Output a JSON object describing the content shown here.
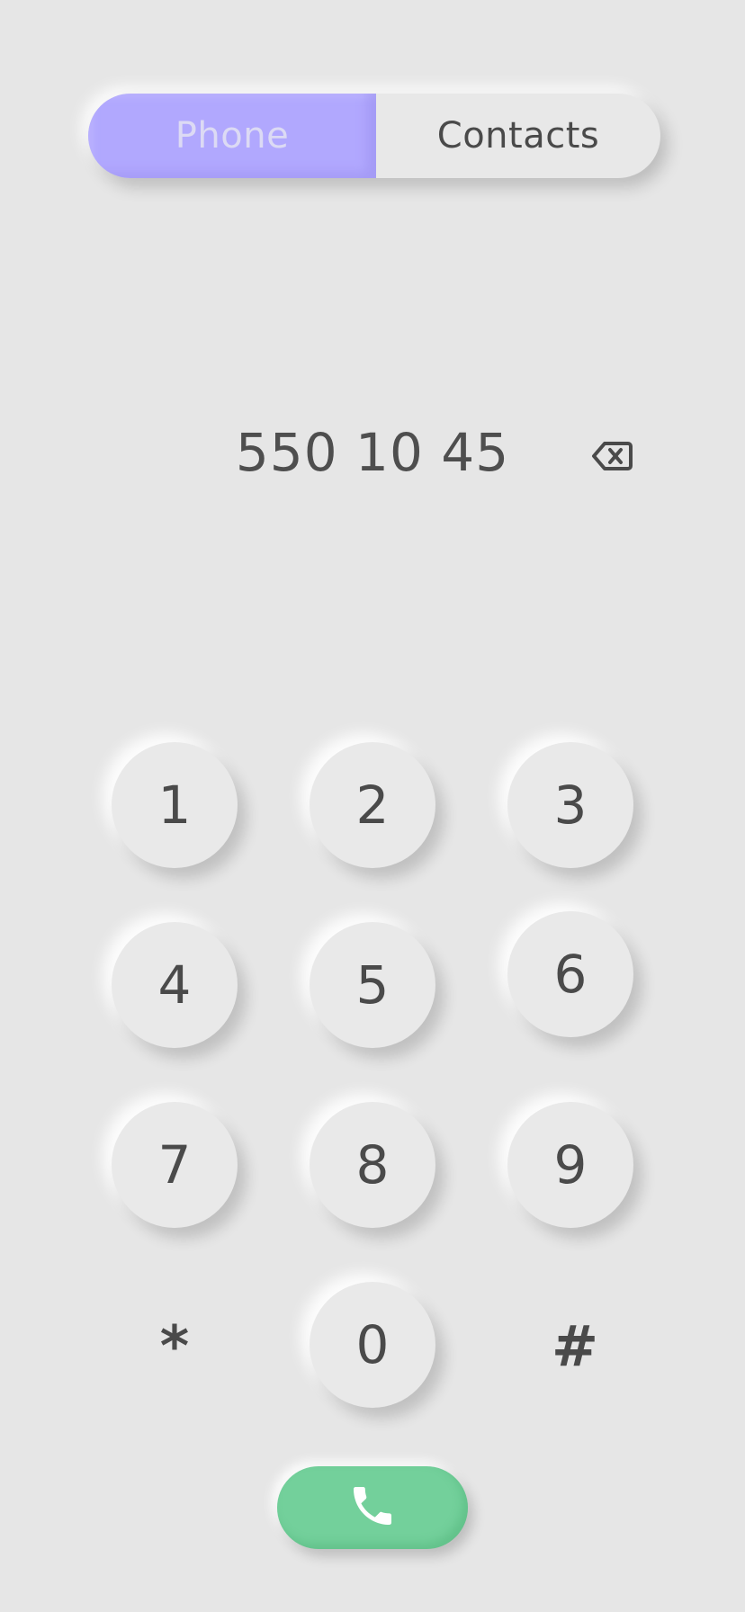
{
  "tabs": {
    "phone_label": "Phone",
    "contacts_label": "Contacts",
    "active": "Phone"
  },
  "display": {
    "number": "550 10 45",
    "backspace_icon": "backspace-icon"
  },
  "keypad": {
    "keys": [
      "1",
      "2",
      "3",
      "4",
      "5",
      "6",
      "7",
      "8",
      "9",
      "*",
      "0",
      "#"
    ]
  },
  "call": {
    "icon": "phone-icon",
    "color": "#73d09b"
  },
  "colors": {
    "background": "#e6e6e6",
    "accent": "#b1a8fe",
    "text": "#4a4a4a",
    "call_green": "#73d09b"
  }
}
